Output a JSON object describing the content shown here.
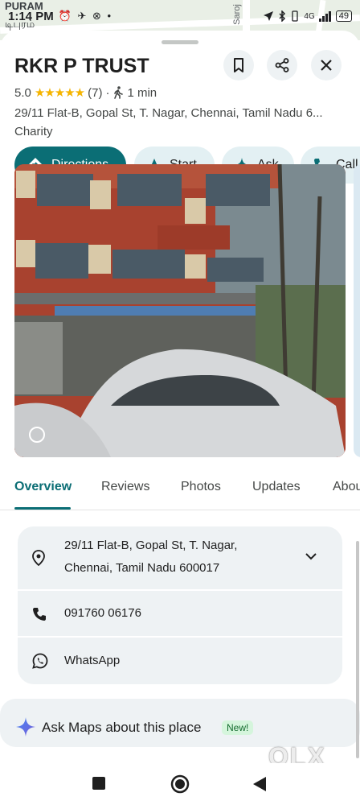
{
  "status_bar": {
    "time": "1:14 PM",
    "left_icons": "⏰ ✈ ⊗ •",
    "network": "4G",
    "battery": "49"
  },
  "map": {
    "place_label": "PURAM",
    "tamil_label": "டிபுரம்",
    "road_label": "Saroj"
  },
  "place": {
    "name": "RKR P TRUST",
    "rating": "5.0",
    "stars": "★★★★★",
    "review_count": "(7)",
    "separator": "·",
    "walk_time": "1 min",
    "address_short": "29/11 Flat-B, Gopal St, T. Nagar, Chennai, Tamil Nadu 6...",
    "category": "Charity"
  },
  "header_buttons": {
    "save": "bookmark-icon",
    "share": "share-icon",
    "close": "close-icon"
  },
  "actions": [
    {
      "label": "Directions",
      "icon": "directions-icon"
    },
    {
      "label": "Start",
      "icon": "navigation-icon"
    },
    {
      "label": "Ask",
      "icon": "sparkle-icon"
    },
    {
      "label": "Call",
      "icon": "phone-icon"
    }
  ],
  "tabs": [
    {
      "label": "Overview",
      "active": true
    },
    {
      "label": "Reviews",
      "active": false
    },
    {
      "label": "Photos",
      "active": false
    },
    {
      "label": "Updates",
      "active": false
    },
    {
      "label": "Abou",
      "active": false
    }
  ],
  "info": {
    "address_line1": "29/11 Flat-B, Gopal St, T. Nagar,",
    "address_line2": "Chennai, Tamil Nadu 600017",
    "phone": "091760 06176",
    "whatsapp": "WhatsApp"
  },
  "ask_maps": {
    "label": "Ask Maps about this place",
    "badge": "New!"
  },
  "watermark": "OLX",
  "colors": {
    "accent": "#0b6e75",
    "chip_bg": "#e3f0f3",
    "card_bg": "#eef2f4",
    "star": "#f5b400"
  }
}
